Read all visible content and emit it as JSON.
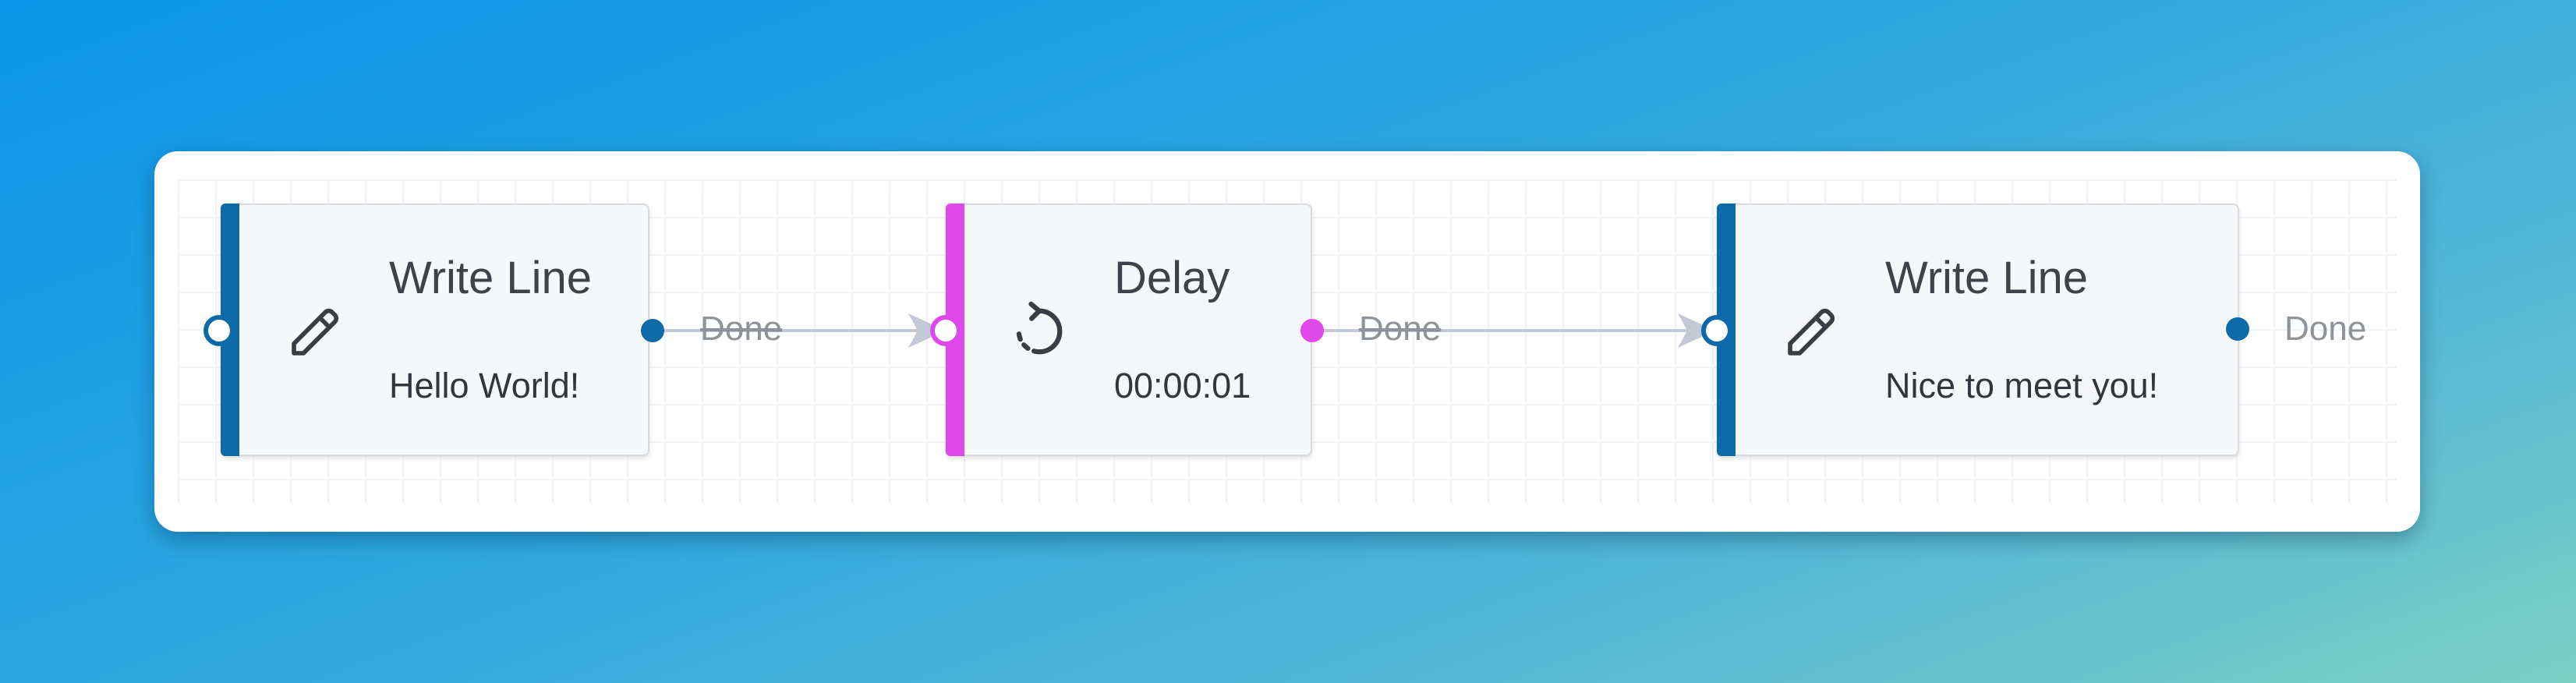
{
  "colors": {
    "write_line_accent": "#0d6aa8",
    "delay_accent": "#df49ec",
    "connector": "#c4c9d6"
  },
  "nodes": [
    {
      "title": "Write Line",
      "subtitle": "Hello World!",
      "icon": "pencil-icon",
      "outcome": "Done"
    },
    {
      "title": "Delay",
      "subtitle": "00:00:01",
      "icon": "timer-reset-icon",
      "outcome": "Done"
    },
    {
      "title": "Write Line",
      "subtitle": "Nice to meet you!",
      "icon": "pencil-icon",
      "outcome": "Done"
    }
  ]
}
